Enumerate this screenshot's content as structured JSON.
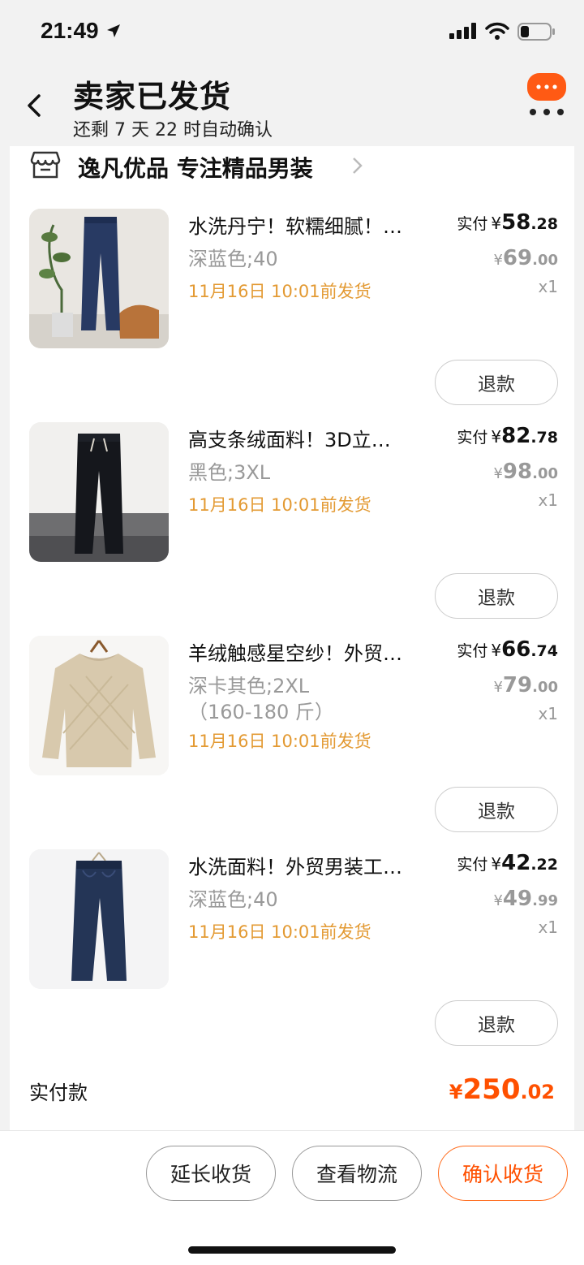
{
  "status_bar": {
    "time": "21:49"
  },
  "nav": {
    "title": "卖家已发货",
    "subtitle": "还剩 7 天 22 时自动确认"
  },
  "shop": {
    "name": "逸凡优品 专注精品男装"
  },
  "items": [
    {
      "title": "水洗丹宁！软糯细腻！…",
      "spec": "深蓝色;40",
      "ship_time": "11月16日 10:01前发货",
      "paid_label": "实付",
      "paid_int": "58",
      "paid_dec": ".28",
      "orig_int": "69",
      "orig_dec": ".00",
      "qty": "x1",
      "refund_label": "退款",
      "image": "navy-jeans-photo"
    },
    {
      "title": "高支条绒面料！3D立…",
      "spec": "黑色;3XL",
      "ship_time": "11月16日 10:01前发货",
      "paid_label": "实付",
      "paid_int": "82",
      "paid_dec": ".78",
      "orig_int": "98",
      "orig_dec": ".00",
      "qty": "x1",
      "refund_label": "退款",
      "image": "black-corduroy-pants-photo"
    },
    {
      "title": "羊绒触感星空纱！外贸…",
      "spec": "深卡其色;2XL",
      "spec_extra": "（160-180 斤）",
      "ship_time": "11月16日 10:01前发货",
      "paid_label": "实付",
      "paid_int": "66",
      "paid_dec": ".74",
      "orig_int": "79",
      "orig_dec": ".00",
      "qty": "x1",
      "refund_label": "退款",
      "image": "beige-sweater-photo"
    },
    {
      "title": "水洗面料！外贸男装工…",
      "spec": "深蓝色;40",
      "ship_time": "11月16日 10:01前发货",
      "paid_label": "实付",
      "paid_int": "42",
      "paid_dec": ".22",
      "orig_int": "49",
      "orig_dec": ".99",
      "qty": "x1",
      "refund_label": "退款",
      "image": "navy-work-pants-photo"
    }
  ],
  "currency_symbol": "¥",
  "total": {
    "label": "实付款",
    "int": "250",
    "dec": ".02"
  },
  "actions": {
    "extend": "延长收货",
    "logistics": "查看物流",
    "confirm": "确认收货"
  },
  "colors": {
    "accent": "#ff5000",
    "ship": "#e39a33",
    "muted": "#999999"
  }
}
